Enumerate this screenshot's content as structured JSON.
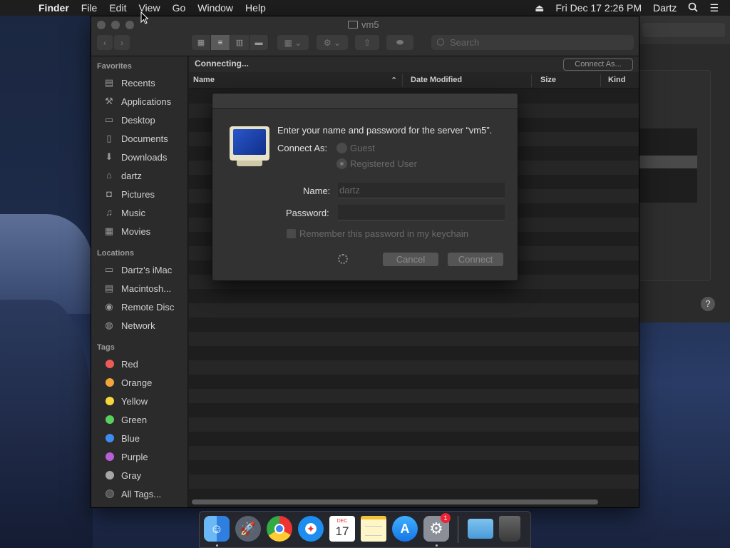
{
  "menubar": {
    "app": "Finder",
    "items": [
      "File",
      "Edit",
      "View",
      "Go",
      "Window",
      "Help"
    ],
    "datetime": "Fri Dec 17  2:26 PM",
    "user": "Dartz"
  },
  "window": {
    "title": "vm5",
    "search_placeholder": "Search",
    "status": "Connecting...",
    "connect_as_button": "Connect As...",
    "columns": [
      "Name",
      "Date Modified",
      "Size",
      "Kind"
    ]
  },
  "sidebar": {
    "favorites_header": "Favorites",
    "favorites": [
      {
        "label": "Recents",
        "icon": "recents-icon"
      },
      {
        "label": "Applications",
        "icon": "applications-icon"
      },
      {
        "label": "Desktop",
        "icon": "desktop-icon"
      },
      {
        "label": "Documents",
        "icon": "documents-icon"
      },
      {
        "label": "Downloads",
        "icon": "downloads-icon"
      },
      {
        "label": "dartz",
        "icon": "home-icon"
      },
      {
        "label": "Pictures",
        "icon": "pictures-icon"
      },
      {
        "label": "Music",
        "icon": "music-icon"
      },
      {
        "label": "Movies",
        "icon": "movies-icon"
      }
    ],
    "locations_header": "Locations",
    "locations": [
      {
        "label": "Dartz’s iMac",
        "icon": "computer-icon"
      },
      {
        "label": "Macintosh...",
        "icon": "disk-icon"
      },
      {
        "label": "Remote Disc",
        "icon": "disc-icon"
      },
      {
        "label": "Network",
        "icon": "network-icon"
      }
    ],
    "tags_header": "Tags",
    "tags": [
      {
        "label": "Red",
        "color": "#ec5b55"
      },
      {
        "label": "Orange",
        "color": "#f3a43a"
      },
      {
        "label": "Yellow",
        "color": "#f5d83c"
      },
      {
        "label": "Green",
        "color": "#58d05e"
      },
      {
        "label": "Blue",
        "color": "#3d8cf0"
      },
      {
        "label": "Purple",
        "color": "#b85fd6"
      },
      {
        "label": "Gray",
        "color": "#a6a6a6"
      },
      {
        "label": "All Tags...",
        "color": "#555555"
      }
    ]
  },
  "dialog": {
    "message": "Enter your name and password for the server “vm5”.",
    "connect_as_label": "Connect As:",
    "guest_label": "Guest",
    "registered_label": "Registered User",
    "name_label": "Name:",
    "name_value": "dartz",
    "password_label": "Password:",
    "password_value": "",
    "remember_label": "Remember this password in my keychain",
    "cancel_label": "Cancel",
    "connect_label": "Connect"
  },
  "dock": {
    "calendar_month": "DEC",
    "calendar_day": "17",
    "badge_count": "1"
  }
}
